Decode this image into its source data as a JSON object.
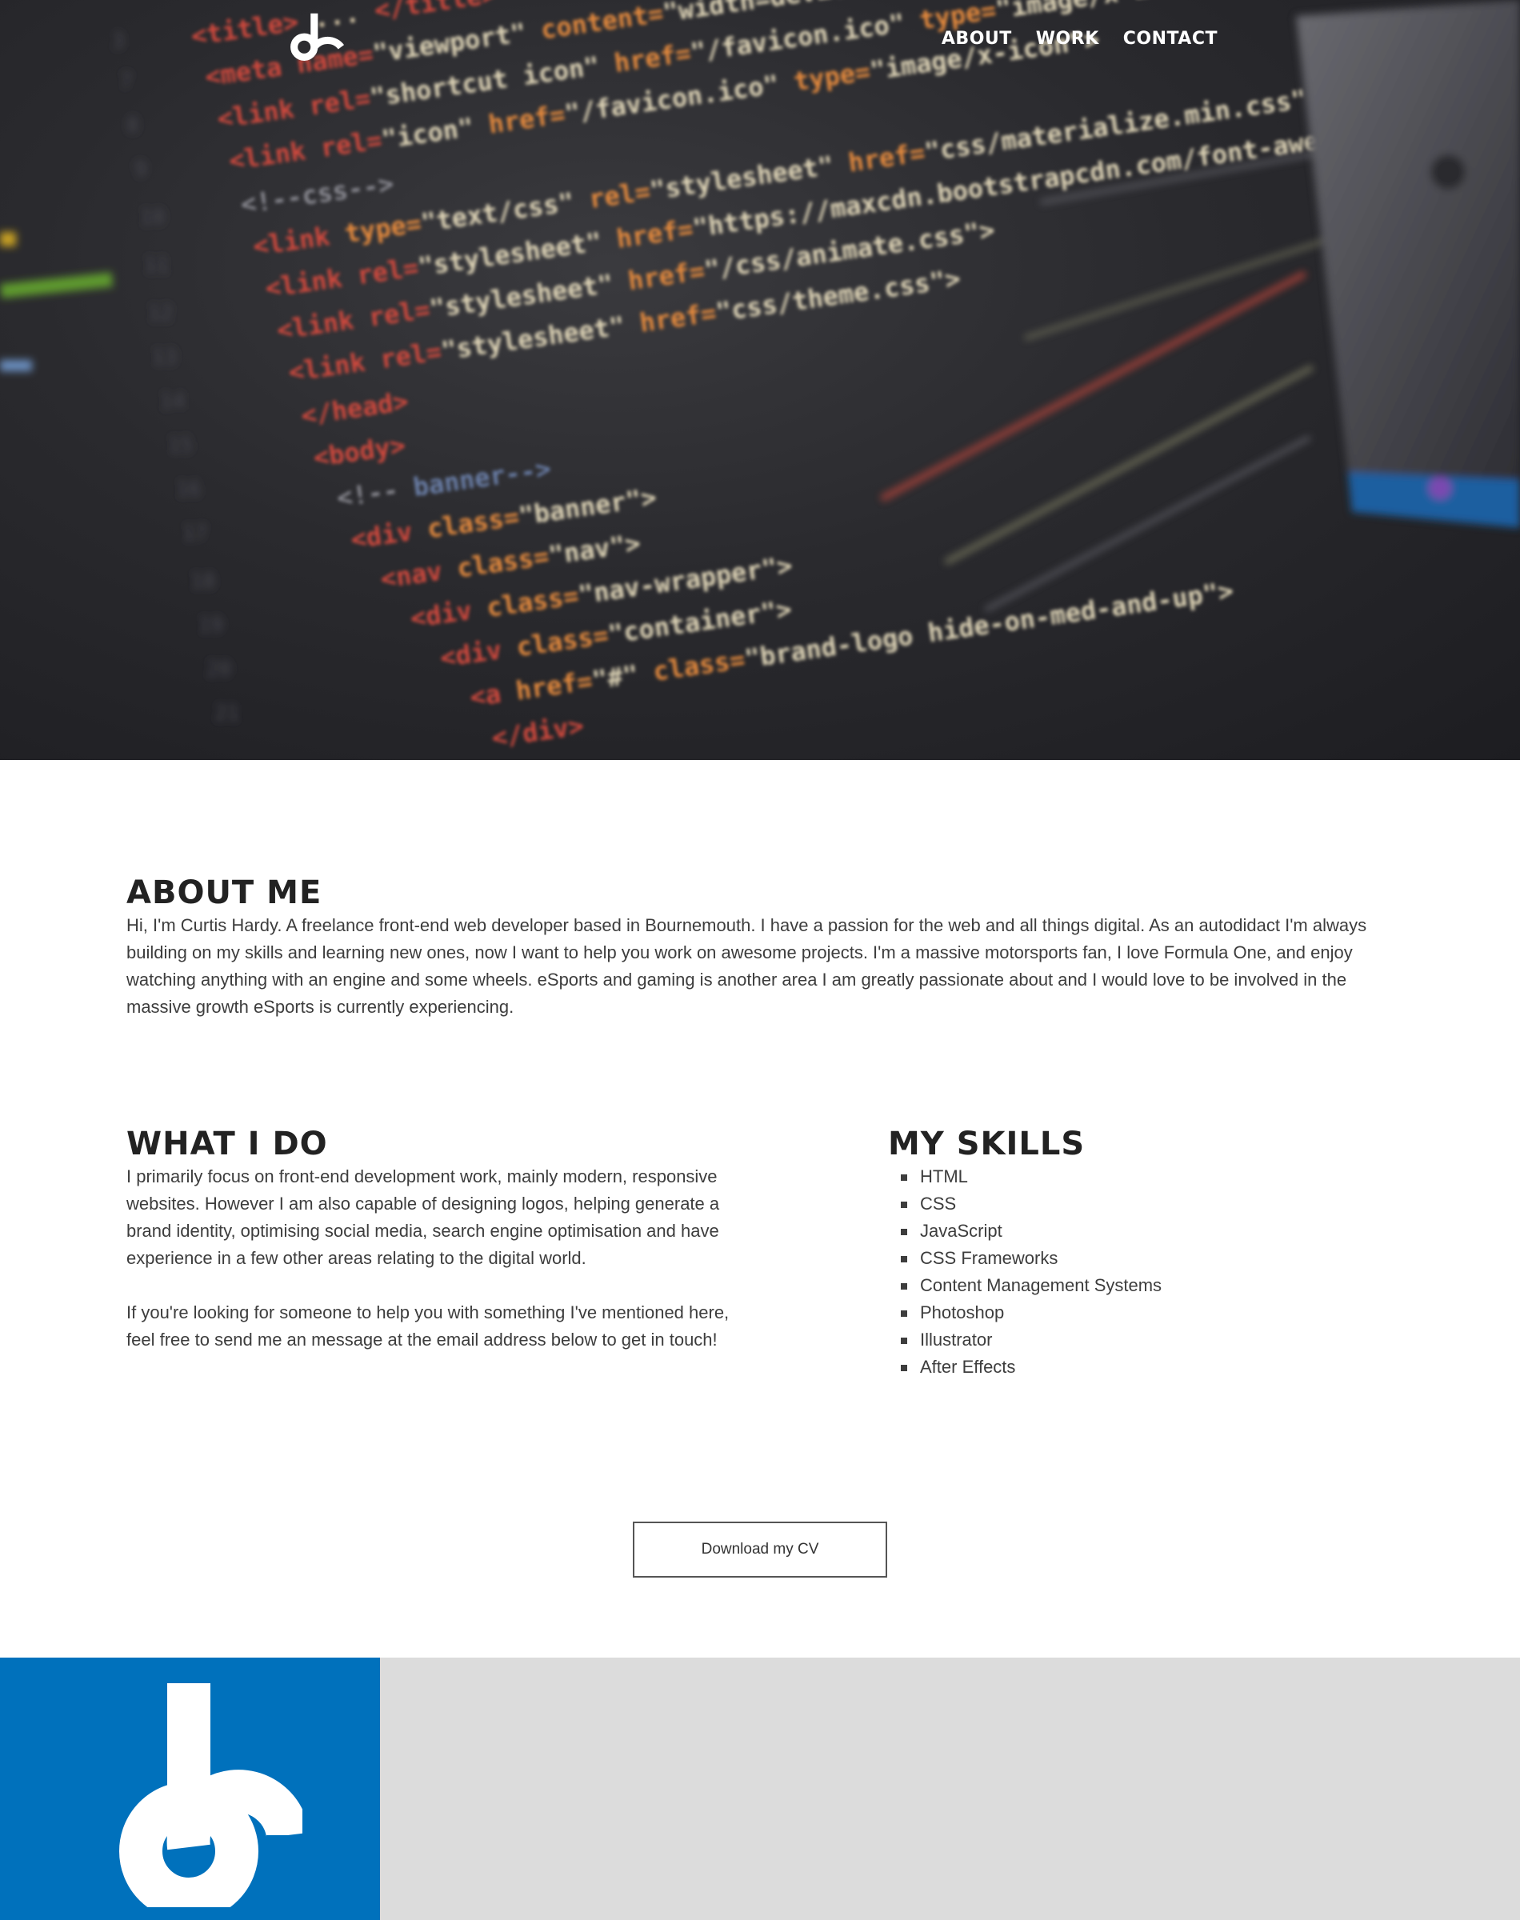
{
  "nav": {
    "items": [
      "ABOUT",
      "WORK",
      "CONTACT"
    ]
  },
  "about": {
    "title": "ABOUT ME",
    "text": "Hi, I'm Curtis Hardy. A freelance front-end web developer based in Bournemouth. I have a passion for the web and all things digital. As an autodidact I'm always building on my skills and learning new ones, now I want to help you work on awesome projects. I'm a massive motorsports fan, I love Formula One, and enjoy watching anything with an engine and some wheels. eSports and gaming is another area I am greatly passionate about and I would love to be involved in the massive growth eSports is currently experiencing."
  },
  "what": {
    "title": "WHAT I DO",
    "paragraphs": [
      "I primarily focus on front-end development work, mainly modern, responsive websites. However I am also capable of designing logos, helping generate a brand identity, optimising social media, search engine optimisation and have experience in a few other areas relating to the digital world.",
      "If you're looking for someone to help you with something I've mentioned here, feel free to send me an message at the email address below to get in touch!"
    ]
  },
  "skills": {
    "title": "MY SKILLS",
    "items": [
      "HTML",
      "CSS",
      "JavaScript",
      "CSS Frameworks",
      "Content Management Systems",
      "Photoshop",
      "Illustrator",
      "After Effects"
    ]
  },
  "cv_button": "Download my CV",
  "icons": {
    "hero_logo": "ch-logo-icon",
    "footer_logo": "ch-logo-icon"
  },
  "colors": {
    "brand_blue": "#0071bc",
    "footer_grey": "#dcdcdc",
    "hero_dark": "#2a2a2e"
  }
}
